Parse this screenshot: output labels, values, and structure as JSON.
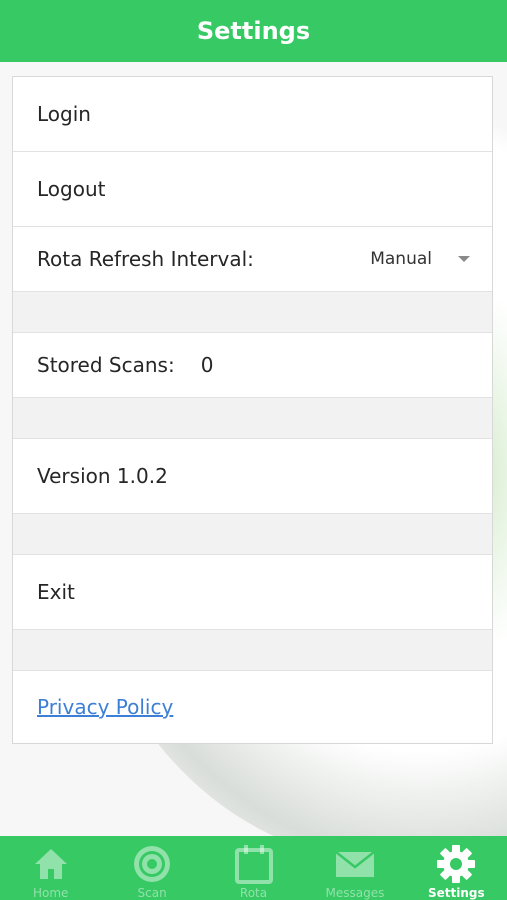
{
  "header": {
    "title": "Settings"
  },
  "settings": {
    "login_label": "Login",
    "logout_label": "Logout",
    "rota_refresh": {
      "label": "Rota Refresh Interval:",
      "selected": "Manual"
    },
    "stored_scans": {
      "label": "Stored Scans:",
      "value": "0"
    },
    "version_label": "Version 1.0.2",
    "exit_label": "Exit",
    "privacy_policy_label": "Privacy Policy"
  },
  "tabs": [
    {
      "label": "Home",
      "icon": "home-icon",
      "active": false
    },
    {
      "label": "Scan",
      "icon": "target-icon",
      "active": false
    },
    {
      "label": "Rota",
      "icon": "calendar-icon",
      "active": false
    },
    {
      "label": "Messages",
      "icon": "envelope-icon",
      "active": false
    },
    {
      "label": "Settings",
      "icon": "gear-icon",
      "active": true
    }
  ],
  "colors": {
    "brand_green": "#37c964",
    "link_blue": "#3d7fd6"
  }
}
